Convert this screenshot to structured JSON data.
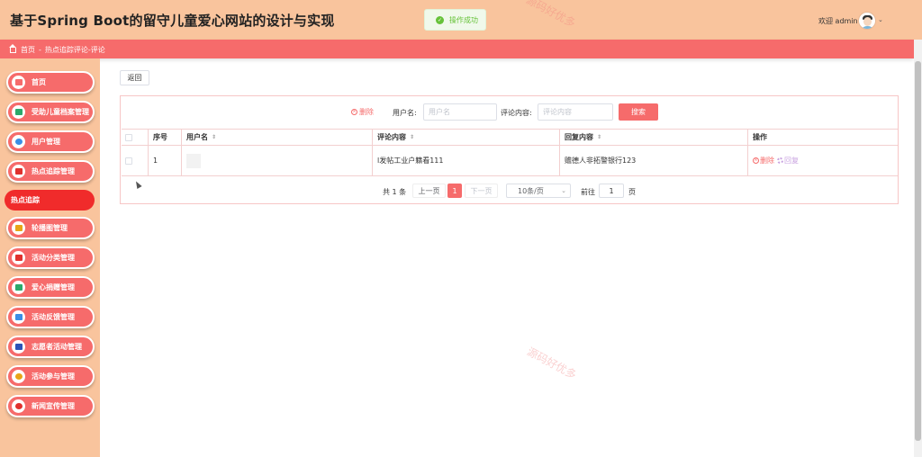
{
  "app": {
    "title": "基于Spring Boot的留守儿童爱心网站的设计与实现"
  },
  "toast": {
    "text": "操作成功",
    "icon": "check-circle-icon"
  },
  "header": {
    "welcome": "欢迎 admin"
  },
  "breadcrumb": {
    "home": "首页",
    "separator": "-",
    "current": "热点追踪评论-评论"
  },
  "sidebar": {
    "items": [
      {
        "label": "首页",
        "icon": "home-icon",
        "color": "#f66b6b"
      },
      {
        "label": "受助儿童档案管理",
        "icon": "folder-icon",
        "color": "#2aa96b"
      },
      {
        "label": "用户管理",
        "icon": "user-icon",
        "color": "#3a8ee6"
      },
      {
        "label": "热点追踪管理",
        "icon": "flame-icon",
        "color": "#e0312e"
      },
      {
        "label": "热点追踪",
        "icon": "",
        "color": ""
      },
      {
        "label": "轮播图管理",
        "icon": "image-icon",
        "color": "#e8a317"
      },
      {
        "label": "活动分类管理",
        "icon": "category-icon",
        "color": "#e0312e"
      },
      {
        "label": "爱心捐赠管理",
        "icon": "gift-icon",
        "color": "#2aa96b"
      },
      {
        "label": "活动反馈管理",
        "icon": "feedback-icon",
        "color": "#3a8ee6"
      },
      {
        "label": "志愿者活动管理",
        "icon": "volunteer-icon",
        "color": "#2b53b8"
      },
      {
        "label": "活动参与管理",
        "icon": "participation-icon",
        "color": "#e8a317"
      },
      {
        "label": "新闻宣传管理",
        "icon": "news-icon",
        "color": "#e0312e"
      }
    ]
  },
  "toolbar": {
    "back": "返回",
    "delete": "删除",
    "search": "搜索"
  },
  "filters": {
    "username_label": "用户名:",
    "username_placeholder": "用户名",
    "comment_label": "评论内容:",
    "comment_placeholder": "评论内容"
  },
  "table": {
    "headers": [
      "序号",
      "用户名",
      "评论内容",
      "回复内容",
      "操作"
    ],
    "rows": [
      {
        "index": "1",
        "username": "",
        "comment": "l发帖工业户籍看111",
        "reply": "赡德人非拓警银行123"
      }
    ],
    "actions": {
      "delete": "删除",
      "reply": "回复"
    }
  },
  "pagination": {
    "total": "共 1 条",
    "prev": "上一页",
    "current": "1",
    "next": "下一页",
    "page_size": "10条/页",
    "goto_label": "前往",
    "goto_value": "1",
    "page_suffix": "页"
  },
  "watermark": {
    "text": "源码好优多"
  }
}
